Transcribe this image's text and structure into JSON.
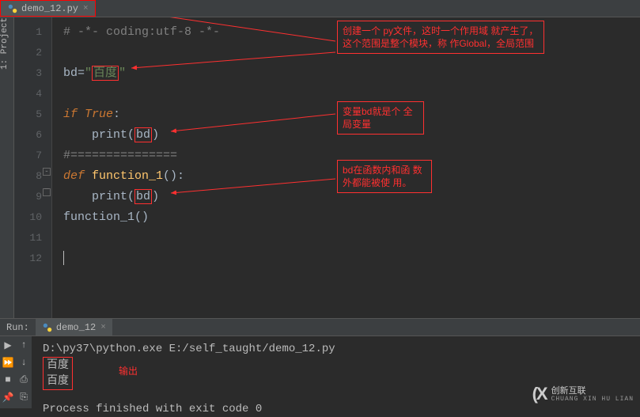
{
  "tab": {
    "filename": "demo_12.py",
    "close": "×"
  },
  "sidebar": {
    "project_label": "1: Project"
  },
  "lines": {
    "n1": "1",
    "n2": "2",
    "n3": "3",
    "n4": "4",
    "n5": "5",
    "n6": "6",
    "n7": "7",
    "n8": "8",
    "n9": "9",
    "n10": "10",
    "n11": "11",
    "n12": "12"
  },
  "code": {
    "l1_comment": "# -*- coding:utf-8 -*-",
    "l3_var": "bd",
    "l3_eq": "=",
    "l3_str_q1": "\"",
    "l3_str_val": "百度",
    "l3_str_q2": "\"",
    "l5_if": "if",
    "l5_true": " True",
    "l5_colon": ":",
    "l6_print": "print",
    "l6_open": "(",
    "l6_bd": "bd",
    "l6_close": ")",
    "l7_sep": "#===============",
    "l8_def": "def",
    "l8_name": " function_1",
    "l8_paren": "():",
    "l9_print": "print",
    "l9_open": "(",
    "l9_bd": "bd",
    "l9_close": ")",
    "l10_call": "function_1",
    "l10_paren": "()"
  },
  "annotations": {
    "a1": "创建一个 py文件，这时一个作用域\n就产生了，这个范围是整个模块，称\n作Global，全局范围",
    "a2": "变量bd就是个\n全局变量",
    "a3": "bd在函数内和函\n数外都能被使\n用。"
  },
  "run": {
    "label": "Run:",
    "tab": "demo_12",
    "tab_close": "×",
    "cmd": "D:\\py37\\python.exe E:/self_taught/demo_12.py",
    "out1": "百度",
    "out2": "百度",
    "out_label": "输出",
    "exit": "Process finished with exit code 0"
  },
  "watermark": {
    "logo": "(X",
    "name": "创新互联",
    "sub": "CHUANG XIN HU LIAN"
  }
}
